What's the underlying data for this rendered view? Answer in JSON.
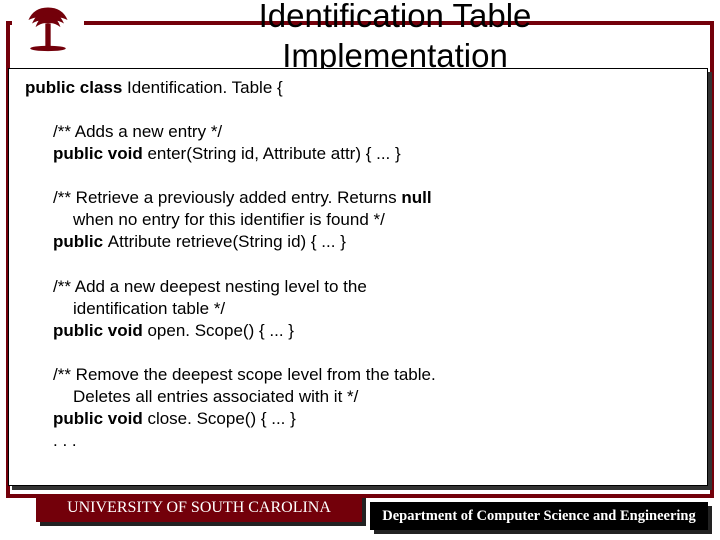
{
  "title_line1": "Identification Table",
  "title_line2": "Implementation",
  "code": {
    "class_decl_pre": "public class ",
    "class_decl_name": "Identification. Table {",
    "enter_comment": "/** Adds a new entry */",
    "enter_sig_pre": "public void ",
    "enter_sig_post": "enter(String id, Attribute attr) { ... }",
    "retrieve_comment_l1_pre": "/** Retrieve a previously added entry. Returns ",
    "retrieve_comment_l1_bold": "null",
    "retrieve_comment_l2": "when no entry for this identifier is found */",
    "retrieve_sig_pre": "public ",
    "retrieve_sig_post": "Attribute retrieve(String id) { ... }",
    "open_comment_l1": "/** Add a new deepest nesting level to the",
    "open_comment_l2": "identification table */",
    "open_sig_pre": "public void ",
    "open_sig_post": "open. Scope() { ... }",
    "close_comment_l1": "/** Remove the deepest scope level from the table.",
    "close_comment_l2": "Deletes all entries associated with it */",
    "close_sig_pre": "public void ",
    "close_sig_post": "close. Scope() { ... }",
    "ellipsis": ". . ."
  },
  "footer": {
    "left": "UNIVERSITY OF SOUTH CAROLINA",
    "right": "Department of Computer Science and Engineering"
  }
}
